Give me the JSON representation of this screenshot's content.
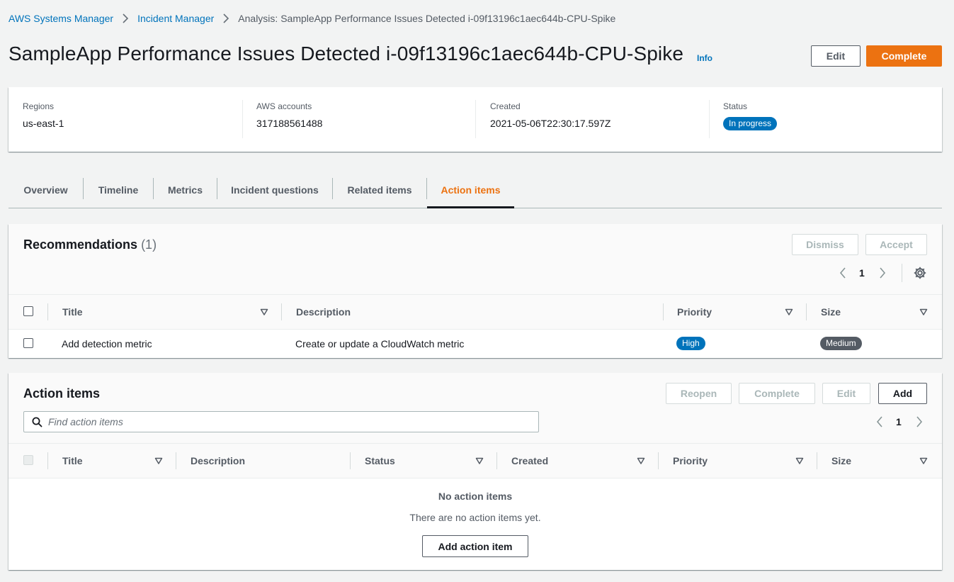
{
  "breadcrumb": {
    "items": [
      "AWS Systems Manager",
      "Incident Manager"
    ],
    "current": "Analysis: SampleApp Performance Issues Detected i-09f13196c1aec644b-CPU-Spike"
  },
  "header": {
    "title": "SampleApp Performance Issues Detected i-09f13196c1aec644b-CPU-Spike",
    "info": "Info",
    "edit_label": "Edit",
    "complete_label": "Complete"
  },
  "summary": {
    "regions_label": "Regions",
    "regions_value": "us-east-1",
    "accounts_label": "AWS accounts",
    "accounts_value": "317188561488",
    "created_label": "Created",
    "created_value": "2021-05-06T22:30:17.597Z",
    "status_label": "Status",
    "status_value": "In progress"
  },
  "tabs": [
    "Overview",
    "Timeline",
    "Metrics",
    "Incident questions",
    "Related items",
    "Action items"
  ],
  "active_tab": "Action items",
  "recommendations": {
    "title": "Recommendations",
    "count": "(1)",
    "dismiss_label": "Dismiss",
    "accept_label": "Accept",
    "page": "1",
    "columns": [
      "Title",
      "Description",
      "Priority",
      "Size"
    ],
    "rows": [
      {
        "title": "Add detection metric",
        "description": "Create or update a CloudWatch metric",
        "priority": "High",
        "size": "Medium"
      }
    ]
  },
  "action_items": {
    "title": "Action items",
    "reopen_label": "Reopen",
    "complete_label": "Complete",
    "edit_label": "Edit",
    "add_label": "Add",
    "search_placeholder": "Find action items",
    "page": "1",
    "columns": [
      "Title",
      "Description",
      "Status",
      "Created",
      "Priority",
      "Size"
    ],
    "empty_title": "No action items",
    "empty_text": "There are no action items yet.",
    "add_item_label": "Add action item"
  },
  "colors": {
    "primary": "#ec7211",
    "link": "#0073bb",
    "status_badge": "#0073bb",
    "size_badge": "#545b64"
  }
}
